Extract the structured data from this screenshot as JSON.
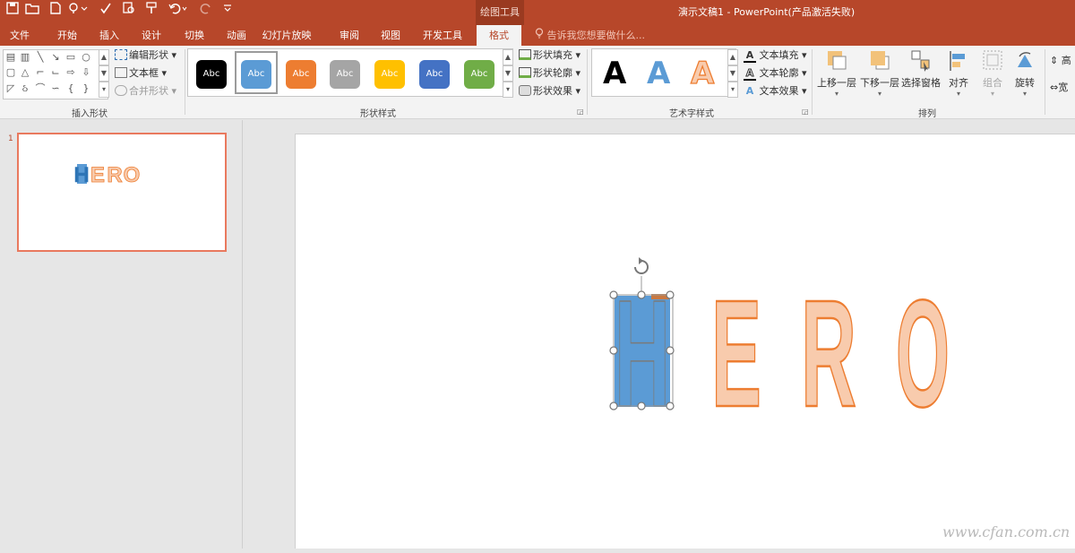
{
  "quick_access": {
    "icons": [
      "save-icon",
      "open-icon",
      "new-icon",
      "touch-mode-icon",
      "spelling-icon",
      "preview-icon",
      "format-painter-icon",
      "undo-icon",
      "redo-icon",
      "customize-icon"
    ]
  },
  "titlebar": {
    "context_label": "绘图工具",
    "title": "演示文稿1 - PowerPoint(产品激活失败)"
  },
  "tabs": [
    "文件",
    "开始",
    "插入",
    "设计",
    "切换",
    "动画",
    "幻灯片放映",
    "审阅",
    "视图",
    "开发工具",
    "格式"
  ],
  "tell_me": "告诉我您想要做什么...",
  "ribbon": {
    "insert_shapes": {
      "label": "插入形状",
      "edit_shape": "编辑形状",
      "text_box": "文本框",
      "merge_shapes": "合并形状"
    },
    "shape_styles": {
      "label": "形状样式",
      "swatch_text": "Abc",
      "fill": "形状填充",
      "outline": "形状轮廓",
      "effects": "形状效果"
    },
    "wordart": {
      "label": "艺术字样式",
      "letters": [
        "A",
        "A",
        "A"
      ],
      "fill": "文本填充",
      "outline": "文本轮廓",
      "effects": "文本效果"
    },
    "arrange": {
      "label": "排列",
      "bring_forward": "上移一层",
      "send_backward": "下移一层",
      "selection_pane": "选择窗格",
      "align": "对齐",
      "group": "组合",
      "rotate": "旋转"
    },
    "size": {
      "height": "高",
      "width": "宽"
    }
  },
  "slide_panel": {
    "number": "1"
  },
  "slide": {
    "letters": [
      "H",
      "E",
      "R",
      "O"
    ]
  },
  "colors": {
    "accent": "#b7472a",
    "swatches": [
      "#000000",
      "#5b9bd5",
      "#ed7d31",
      "#a5a5a5",
      "#ffc000",
      "#4472c4",
      "#70ad47"
    ],
    "letter_blue": "#5b9bd5",
    "letter_peach": "#f8cbad",
    "letter_outline": "#ed7d31"
  },
  "watermark": "www.cfan.com.cn"
}
